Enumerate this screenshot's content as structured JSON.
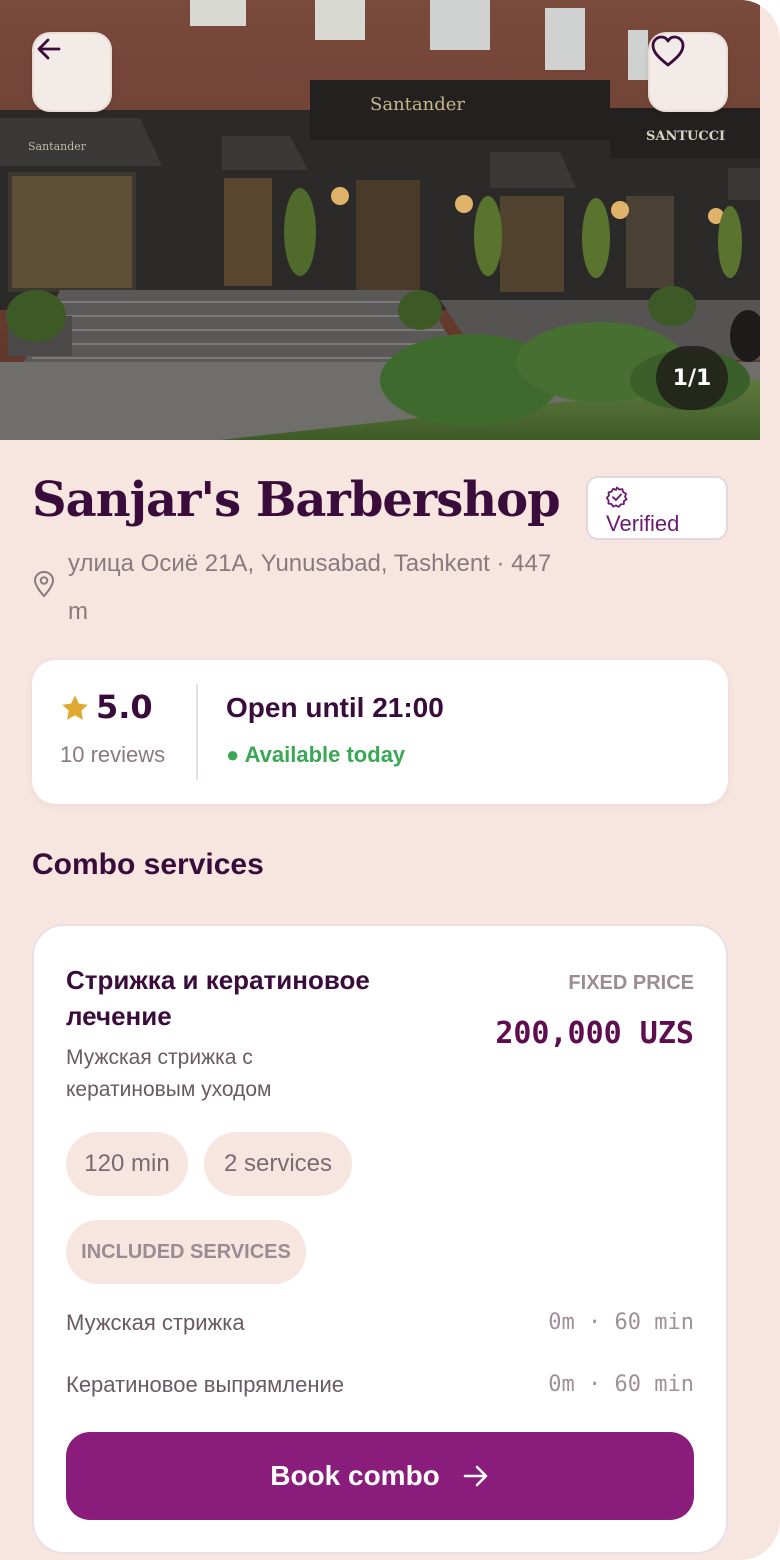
{
  "hero": {
    "photo_sign_left": "Santander",
    "photo_sign_center": "Santander",
    "photo_sign_right": "SANTUCCI",
    "image_counter": "1/1",
    "back_icon": "arrow-left-icon",
    "favorite_icon": "heart-icon"
  },
  "shop": {
    "name": "Sanjar's Barbershop",
    "verified_label": "Verified",
    "address": "улица Осиё 21А, Yunusabad, Tashkent · 447 m"
  },
  "stats": {
    "rating": "5.0",
    "reviews": "10 reviews",
    "open_status": "Open until 21:00",
    "availability": "● Available today"
  },
  "combo_section": {
    "title": "Combo services",
    "combo": {
      "name": "Стрижка и кератиновое лечение",
      "description": "Мужская стрижка с кератиновым уходом",
      "price_label": "FIXED PRICE",
      "price": "200,000 UZS",
      "duration": "120 min",
      "services_count": "2 services",
      "included_label": "INCLUDED SERVICES",
      "services": [
        {
          "name": "Мужская стрижка",
          "duration": "0m · 60 min"
        },
        {
          "name": "Кератиновое выпрямление",
          "duration": "0m · 60 min"
        }
      ],
      "book_label": "Book combo"
    }
  },
  "colors": {
    "page_bg": "#f6e6df",
    "accent": "#8a1c7c",
    "heading": "#3a0c3c",
    "available": "#3aa755",
    "star": "#e0a82e"
  }
}
